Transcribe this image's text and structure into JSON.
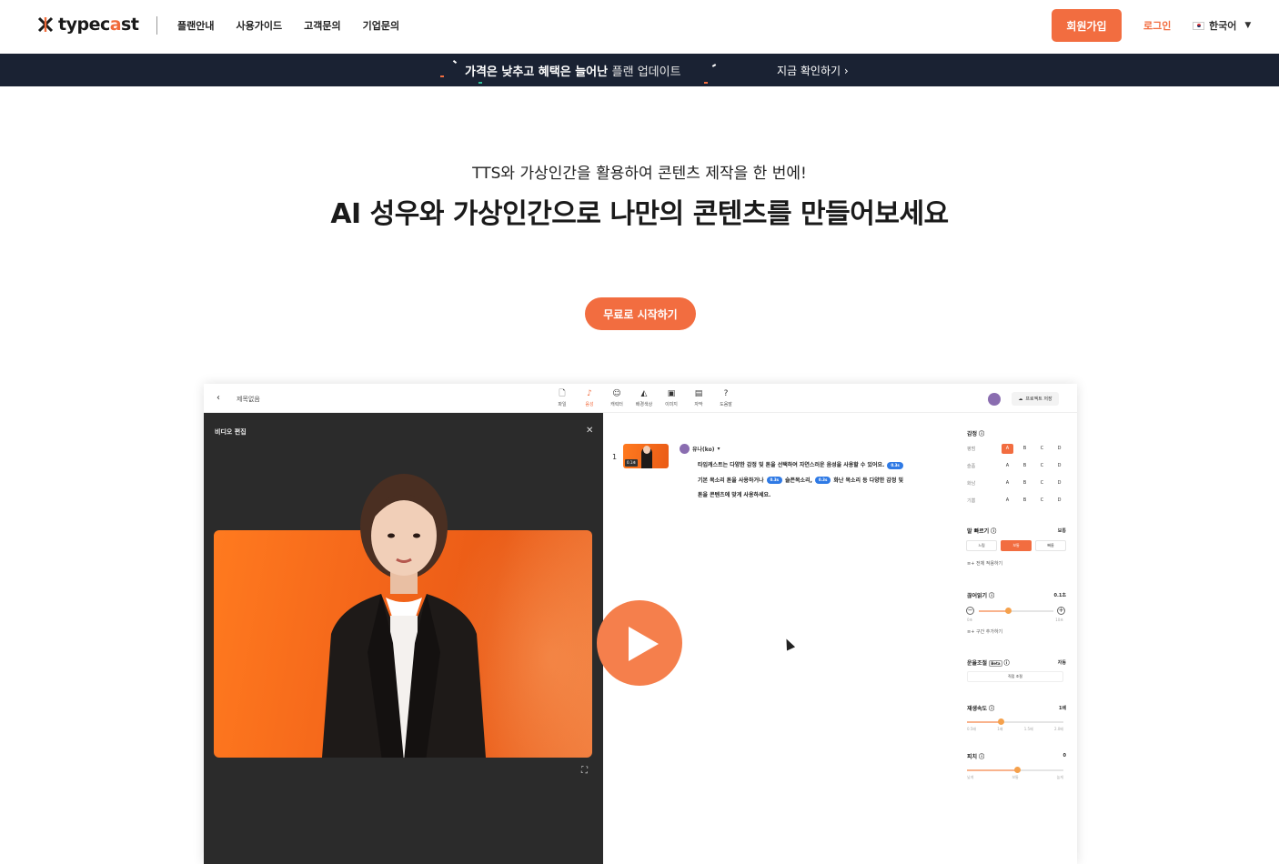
{
  "header": {
    "logo_text_a": "typec",
    "logo_text_accent": "a",
    "logo_text_b": "st",
    "nav": [
      "플랜안내",
      "사용가이드",
      "고객문의",
      "기업문의"
    ],
    "signup_label": "회원가입",
    "login_label": "로그인",
    "language": "한국어"
  },
  "banner": {
    "text_bold": "가격은 낮추고 혜택은 늘어난",
    "text_light": "플랜 업데이트",
    "link_label": "지금 확인하기 ›"
  },
  "hero": {
    "subtitle": "TTS와 가상인간을 활용하여 콘텐츠 제작을 한 번에!",
    "title": "AI 성우와 가상인간으로 나만의 콘텐츠를 만들어보세요",
    "cta_label": "무료로 시작하기"
  },
  "app": {
    "back_icon": "chevron-left-icon",
    "doc_title": "제목없음",
    "toolbar": [
      {
        "label": "파일",
        "icon": "file-icon",
        "active": false
      },
      {
        "label": "음성",
        "icon": "voice-icon",
        "active": true
      },
      {
        "label": "캐릭터",
        "icon": "character-icon",
        "active": false
      },
      {
        "label": "배경색상",
        "icon": "background-icon",
        "active": false
      },
      {
        "label": "이미지",
        "icon": "image-icon",
        "active": false
      },
      {
        "label": "자막",
        "icon": "subtitle-icon",
        "active": false
      },
      {
        "label": "도움말",
        "icon": "help-icon",
        "active": false
      }
    ],
    "download_label": "프로젝트 저장",
    "video_edit_title": "비디오 편집",
    "row_number": "1",
    "thumb_tag": "0.1초",
    "speaker": "유나(ko)",
    "script": {
      "line1": "타입캐스트는 다양한 감정 및 톤을 선택하여 자연스러운 음성을 사용할 수 있어요.",
      "pill1": "0.3s",
      "line2a": "기본 목소리 톤을 사용하거나",
      "pill2": "0.3s",
      "line2b": "슬픈목소리,",
      "pill3": "0.3s",
      "line2c": "화난 목소리 등 다양한 감정 및",
      "line3": "톤을 콘텐츠에 맞게 사용하세요."
    },
    "settings": {
      "emotion_label": "감정",
      "emotions": [
        {
          "label": "평범",
          "options": [
            "A",
            "B",
            "C",
            "D"
          ],
          "selected": 0
        },
        {
          "label": "슬픔",
          "options": [
            "A",
            "B",
            "C",
            "D"
          ],
          "selected": -1
        },
        {
          "label": "화남",
          "options": [
            "A",
            "B",
            "C",
            "D"
          ],
          "selected": -1
        },
        {
          "label": "기쁨",
          "options": [
            "A",
            "B",
            "C",
            "D"
          ],
          "selected": -1
        }
      ],
      "speed_label": "말 빠르기",
      "speed_value": "보통",
      "speed_options": [
        "느림",
        "보통",
        "빠름"
      ],
      "speed_selected": 1,
      "apply_all": "전체 적용하기",
      "pause_label": "끊어읽기",
      "pause_value": "0.1초",
      "pause_ticks": [
        "0초",
        "10초"
      ],
      "pause_level": 0.4,
      "add_section": "구간 추가하기",
      "prosody_label": "운율조절",
      "prosody_badge": "Beta",
      "prosody_value": "자동",
      "prosody_button": "직접 조절",
      "playback_label": "재생속도",
      "playback_value": "1배",
      "playback_ticks": [
        "0.5배",
        "1배",
        "1.5배",
        "2.0배"
      ],
      "playback_level": 0.35,
      "pitch_label": "피치",
      "pitch_value": "0",
      "pitch_ticks": [
        "낮게",
        "보통",
        "높게"
      ],
      "pitch_level": 0.52
    }
  },
  "colors": {
    "accent": "#f26d40",
    "banner_bg": "#1a2233",
    "editor_bg": "#2b2b2b"
  }
}
